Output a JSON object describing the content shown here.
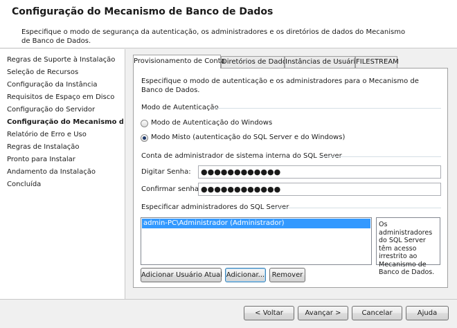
{
  "header": {
    "title": "Configuração do Mecanismo de Banco de Dados",
    "description": "Especifique o modo de segurança da autenticação, os administradores e os diretórios de dados do Mecanismo de Banco de Dados."
  },
  "sidebar": {
    "items": [
      {
        "label": "Regras de Suporte à Instalação"
      },
      {
        "label": "Seleção de Recursos"
      },
      {
        "label": "Configuração da Instância"
      },
      {
        "label": "Requisitos de Espaço em Disco"
      },
      {
        "label": "Configuração do Servidor"
      },
      {
        "label": "Configuração do Mecanismo de B..."
      },
      {
        "label": "Relatório de Erro e Uso"
      },
      {
        "label": "Regras de Instalação"
      },
      {
        "label": "Pronto para Instalar"
      },
      {
        "label": "Andamento da Instalação"
      },
      {
        "label": "Concluída"
      }
    ],
    "active_index": 5
  },
  "tabs": [
    {
      "label": "Provisionamento de Conta"
    },
    {
      "label": "Diretórios de Dados"
    },
    {
      "label": "Instâncias de Usuário"
    },
    {
      "label": "FILESTREAM"
    }
  ],
  "panel": {
    "intro": "Especifique o modo de autenticação e os administradores para o Mecanismo de Banco de Dados.",
    "auth_group_label": "Modo de Autenticação",
    "radio_windows_label": "Modo de Autenticação do Windows",
    "radio_mixed_label": "Modo Misto (autenticação do SQL Server e do Windows)",
    "selected_mode": "mixed",
    "sa_group_label": "Conta de administrador de sistema interna do SQL Server",
    "password_label": "Digitar Senha:",
    "password_value": "●●●●●●●●●●●●",
    "confirm_label": "Confirmar senha:",
    "confirm_value": "●●●●●●●●●●●●",
    "admins_group_label": "Especificar administradores do SQL Server",
    "admins": [
      "admin-PC\\Administrador (Administrador)"
    ],
    "admins_help": "Os administradores do SQL Server têm acesso irrestrito ao Mecanismo de Banco de Dados.",
    "add_current_user_label": "Adicionar Usuário Atual",
    "add_label": "Adicionar...",
    "remove_label": "Remover"
  },
  "footer": {
    "back_label": "< Voltar",
    "next_label": "Avançar >",
    "cancel_label": "Cancelar",
    "help_label": "Ajuda"
  },
  "colors": {
    "selection": "#3399ff",
    "window_bg": "#f0f0f0",
    "panel_bg": "#ffffff"
  }
}
